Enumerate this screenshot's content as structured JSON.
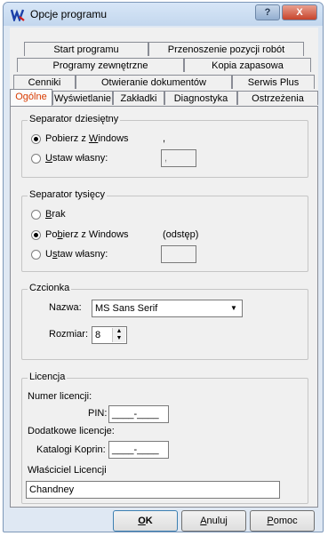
{
  "window": {
    "title": "Opcje programu",
    "help_label": "?",
    "close_label": "X"
  },
  "tabs": {
    "row1": [
      "Start programu",
      "Przenoszenie pozycji robót"
    ],
    "row2": [
      "Programy zewnętrzne",
      "Kopia zapasowa"
    ],
    "row3": [
      "Cenniki",
      "Otwieranie dokumentów",
      "Serwis Plus"
    ],
    "row4": [
      "Ogólne",
      "Wyświetlanie",
      "Zakładki",
      "Diagnostyka",
      "Ostrzeżenia"
    ],
    "active": "Ogólne"
  },
  "decimal_separator": {
    "title": "Separator dziesiętny",
    "option_windows_pre": "Pobierz z ",
    "option_windows_key": "W",
    "option_windows_post": "indows",
    "option_custom_key": "U",
    "option_custom_post": "staw własny:",
    "windows_value": ",",
    "custom_value": ","
  },
  "thousands_separator": {
    "title": "Separator tysięcy",
    "option_none_key": "B",
    "option_none_post": "rak",
    "option_windows_pre": "Po",
    "option_windows_key": "b",
    "option_windows_post": "ierz z Windows",
    "option_custom_pre": "U",
    "option_custom_key": "s",
    "option_custom_post": "taw własny:",
    "windows_value": "(odstęp)",
    "custom_value": ""
  },
  "font": {
    "title": "Czcionka",
    "name_label": "Nazwa:",
    "name_value": "MS Sans Serif",
    "size_label": "Rozmiar:",
    "size_value": "8"
  },
  "license": {
    "title": "Licencja",
    "number_label": "Numer licencji:",
    "pin_label": "PIN:",
    "pin_value": "____-____",
    "additional_label": "Dodatkowe licencje:",
    "koprin_label": "Katalogi Koprin:",
    "koprin_value": "____-____",
    "owner_label": "Właściciel Licencji",
    "owner_value": "Chandney"
  },
  "buttons": {
    "ok_key": "O",
    "ok_post": "K",
    "cancel_key": "A",
    "cancel_post": "nuluj",
    "help_key": "P",
    "help_post": "omoc"
  }
}
